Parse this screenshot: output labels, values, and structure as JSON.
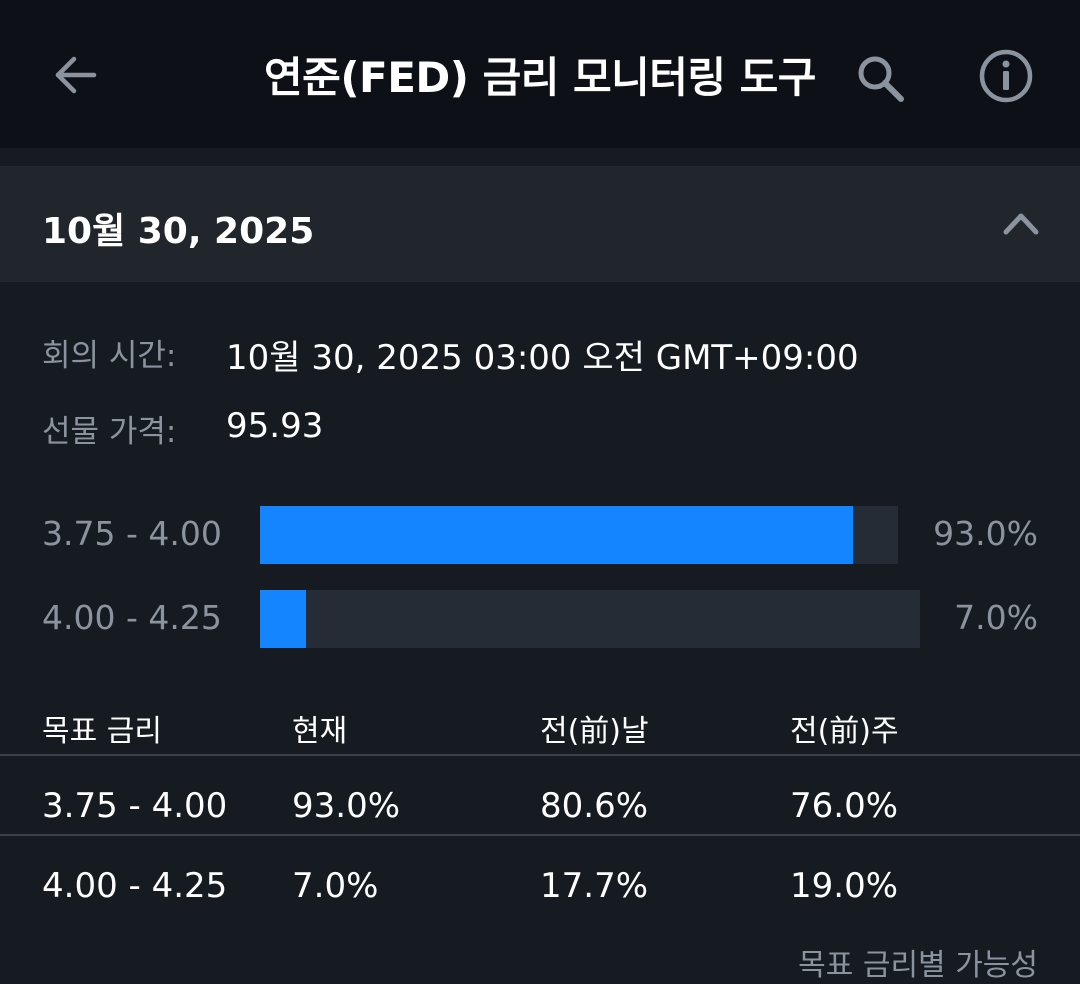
{
  "header": {
    "title": "연준(FED) 금리 모니터링 도구",
    "icons": [
      "back-arrow-icon",
      "search-icon",
      "info-icon"
    ]
  },
  "meeting": {
    "date_label": "10월 30, 2025",
    "meeting_time_label": "회의 시간:",
    "meeting_time_value": "10월 30, 2025 03:00 오전 GMT+09:00",
    "futures_price_label": "선물 가격:",
    "futures_price_value": "95.93"
  },
  "probability_bars": [
    {
      "range": "3.75 - 4.00",
      "percent_text": "93.0%",
      "percent": 93.0
    },
    {
      "range": "4.00 - 4.25",
      "percent_text": "7.0%",
      "percent": 7.0
    }
  ],
  "table": {
    "headers": [
      "목표 금리",
      "현재",
      "전(前)날",
      "전(前)주"
    ],
    "rows": [
      [
        "3.75 - 4.00",
        "93.0%",
        "80.6%",
        "76.0%"
      ],
      [
        "4.00 - 4.25",
        "7.0%",
        "17.7%",
        "19.0%"
      ]
    ]
  },
  "footer_note": "목표 금리별 가능성",
  "colors": {
    "background": "#161b22",
    "topbar": "#0d1117",
    "section_header": "#21262d",
    "bar_fill": "#1584ff",
    "bar_track": "#262c35",
    "muted_text": "#8b949e"
  }
}
